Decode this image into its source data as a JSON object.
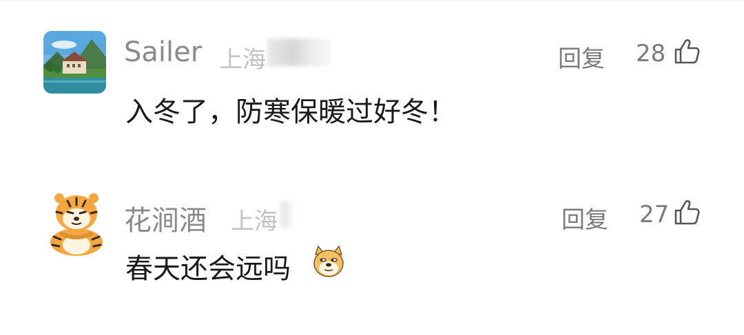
{
  "comments": [
    {
      "author": "Sailer",
      "location": "上海",
      "reply_label": "回复",
      "likes": "28",
      "text": "入冬了，防寒保暖过好冬！",
      "avatar_icon": "landscape-castle-avatar"
    },
    {
      "author": "花涧酒",
      "location": "上海",
      "reply_label": "回复",
      "likes": "27",
      "text": "春天还会远吗",
      "avatar_icon": "tiger-avatar",
      "emoji_icon": "doge-emoji-icon"
    }
  ],
  "colors": {
    "author": "#8a8a8a",
    "location": "#c2c2c2",
    "text": "#1a1a1a",
    "meta": "#7a7a7a",
    "background": "#ffffff"
  }
}
